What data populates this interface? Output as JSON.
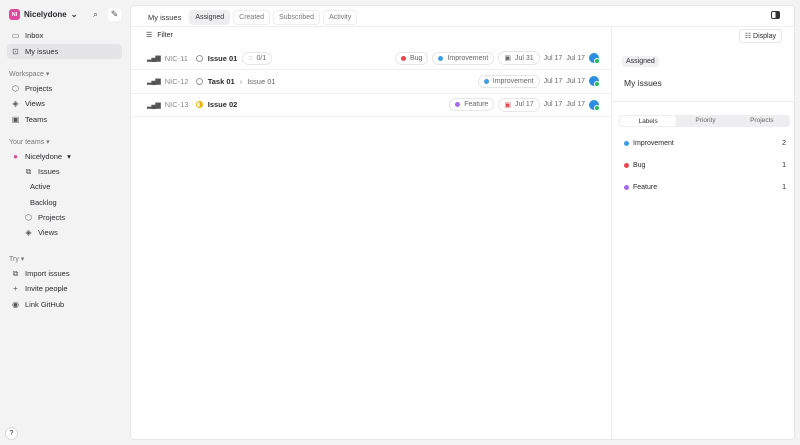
{
  "workspace": {
    "initials": "NI",
    "name": "Nicelydone"
  },
  "sidebar": {
    "inbox": "Inbox",
    "my_issues": "My issues",
    "workspace_label": "Workspace",
    "projects": "Projects",
    "views": "Views",
    "teams": "Teams",
    "your_teams_label": "Your teams",
    "team_name": "Nicelydone",
    "issues": "Issues",
    "active": "Active",
    "backlog": "Backlog",
    "team_projects": "Projects",
    "team_views": "Views",
    "try_label": "Try",
    "import": "Import issues",
    "invite": "Invite people",
    "github": "Link GitHub",
    "help": "?"
  },
  "header": {
    "title": "My issues",
    "tabs": [
      "Assigned",
      "Created",
      "Subscribed",
      "Activity"
    ],
    "filter": "Filter",
    "display": "Display"
  },
  "issues": [
    {
      "id": "NIC-11",
      "title": "Issue 01",
      "sub": "0/1",
      "labels": [
        {
          "name": "Bug",
          "color": "#e5484d"
        },
        {
          "name": "Improvement",
          "color": "#3b9ee8"
        }
      ],
      "due": "Jul 31",
      "d1": "Jul 17",
      "d2": "Jul 17"
    },
    {
      "id": "NIC-12",
      "title": "Task 01",
      "parent": "Issue 01",
      "labels": [
        {
          "name": "Improvement",
          "color": "#3b9ee8"
        }
      ],
      "d1": "Jul 17",
      "d2": "Jul 17"
    },
    {
      "id": "NIC-13",
      "title": "Issue 02",
      "labels": [
        {
          "name": "Feature",
          "color": "#a86be8"
        }
      ],
      "due": "Jul 17",
      "d1": "Jul 17",
      "d2": "Jul 17"
    }
  ],
  "panel": {
    "badge": "Assigned",
    "title": "My issues",
    "tabs": [
      "Labels",
      "Priority",
      "Projects"
    ],
    "labels": [
      {
        "name": "Improvement",
        "count": "2",
        "color": "#3b9ee8"
      },
      {
        "name": "Bug",
        "count": "1",
        "color": "#e5484d"
      },
      {
        "name": "Feature",
        "count": "1",
        "color": "#a86be8"
      }
    ]
  }
}
